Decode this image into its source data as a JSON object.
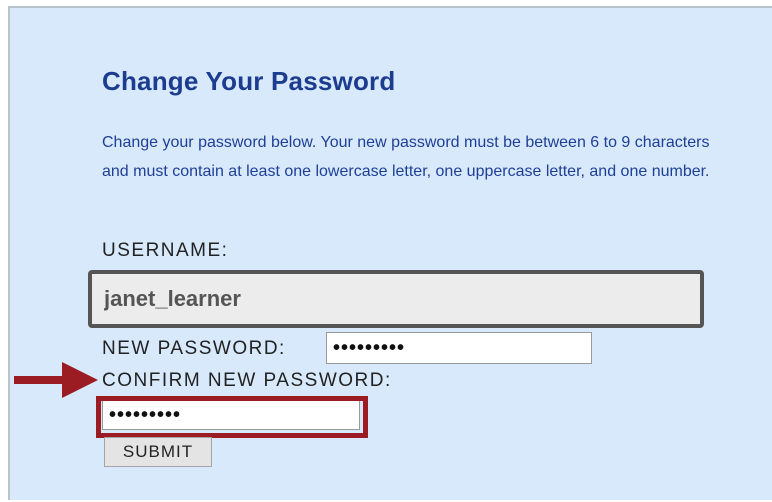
{
  "form": {
    "title": "Change Your Password",
    "description": "Change your password below. Your new password must be between 6 to 9 characters and must contain at least one lowercase letter, one uppercase letter, and one number.",
    "username_label": "USERNAME:",
    "username_value": "janet_learner",
    "new_password_label": "NEW PASSWORD:",
    "new_password_value": "•••••••••",
    "confirm_password_label": "CONFIRM NEW PASSWORD:",
    "confirm_password_value": "•••••••••",
    "submit_label": "SUBMIT"
  },
  "annotation": {
    "arrow_icon": "right-arrow-icon",
    "arrow_color": "#9b1c23",
    "highlight_color": "#9b1c23"
  },
  "colors": {
    "background": "#d7e9fb",
    "title": "#1c3c8f",
    "description": "#1f3f97"
  }
}
